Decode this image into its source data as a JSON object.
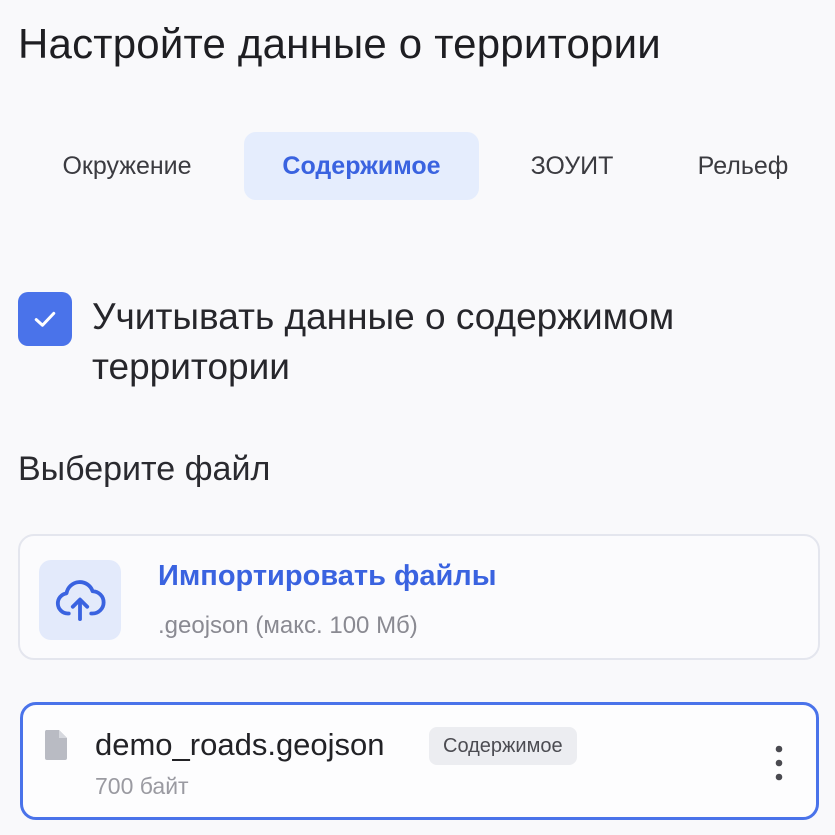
{
  "header": {
    "title": "Настройте данные о территории"
  },
  "tabs": [
    {
      "label": "Окружение",
      "active": false
    },
    {
      "label": "Содержимое",
      "active": true
    },
    {
      "label": "ЗОУИТ",
      "active": false
    },
    {
      "label": "Рельеф",
      "active": false
    }
  ],
  "include_content": {
    "checked": true,
    "label": "Учитывать данные о содержимом территории"
  },
  "file_section": {
    "label": "Выберите файл"
  },
  "import": {
    "icon": "cloud-upload-icon",
    "title": "Импортировать файлы",
    "hint": ".geojson (макс. 100 Мб)"
  },
  "file": {
    "icon": "document-icon",
    "name": "demo_roads.geojson",
    "tag": "Содержимое",
    "size": "700 байт",
    "menu_icon": "more-vertical-icon"
  },
  "colors": {
    "accent": "#4a73ea",
    "accent_text": "#3a63e0",
    "active_tab_bg": "#e5edfd",
    "background": "#f9f9fb"
  }
}
